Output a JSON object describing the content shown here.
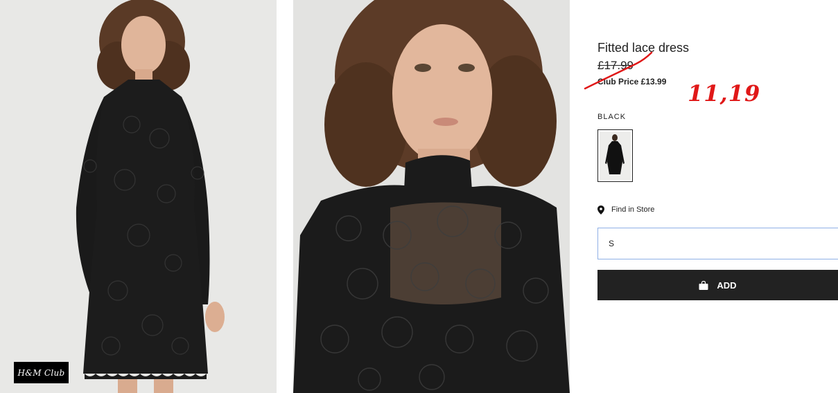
{
  "badge": {
    "label": "H&M Club"
  },
  "product": {
    "title": "Fitted lace dress",
    "price": "£17.99",
    "club_price": "Club Price £13.99"
  },
  "annotation": {
    "handwritten_price": "11,19",
    "color": "#e01818"
  },
  "color_option": {
    "label": "BLACK"
  },
  "store": {
    "label": "Find in Store",
    "icon": "location-pin-icon"
  },
  "size_select": {
    "value": "S"
  },
  "add_button": {
    "label": "ADD",
    "icon": "shopping-bag-icon"
  },
  "colors": {
    "accent_border": "#8fb0e6",
    "button_bg": "#222222"
  }
}
